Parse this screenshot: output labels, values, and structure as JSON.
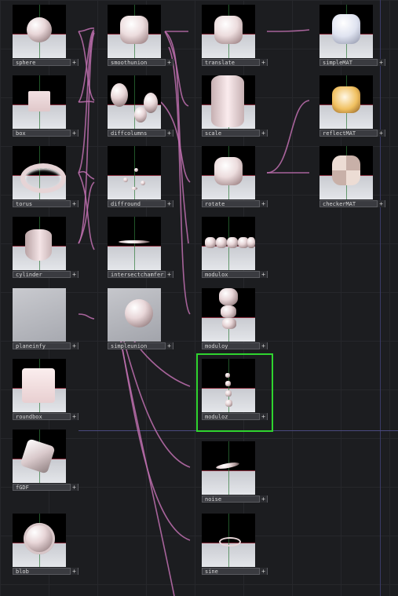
{
  "canvas": {
    "background": "#1c1d20",
    "grid": "#26272b",
    "wire": "#c070b0",
    "selection": "#2fd42f"
  },
  "nodes": [
    {
      "id": "sphere",
      "label": "sphere",
      "shape": "sphere"
    },
    {
      "id": "box",
      "label": "box",
      "shape": "box"
    },
    {
      "id": "torus",
      "label": "torus",
      "shape": "torus"
    },
    {
      "id": "cylinder",
      "label": "cylinder",
      "shape": "cylinder"
    },
    {
      "id": "planeinfy",
      "label": "planeinfy",
      "shape": "plane"
    },
    {
      "id": "roundbox",
      "label": "roundbox",
      "shape": "roundbox"
    },
    {
      "id": "fgdf",
      "label": "fGDF",
      "shape": "gdf"
    },
    {
      "id": "blob",
      "label": "blob",
      "shape": "blob"
    },
    {
      "id": "smoothunion",
      "label": "smoothunion",
      "shape": "roundcube"
    },
    {
      "id": "diffcolumns",
      "label": "diffcolumns",
      "shape": "columns"
    },
    {
      "id": "diffround",
      "label": "diffround",
      "shape": "scatter"
    },
    {
      "id": "intersectchamfer",
      "label": "intersectchamfer",
      "shape": "flat"
    },
    {
      "id": "simpleunion",
      "label": "simpleunion",
      "shape": "sphereplane"
    },
    {
      "id": "translate",
      "label": "translate",
      "shape": "roundcube"
    },
    {
      "id": "scale",
      "label": "scale",
      "shape": "tall"
    },
    {
      "id": "rotate",
      "label": "rotate",
      "shape": "roundcube"
    },
    {
      "id": "modulox",
      "label": "modulox",
      "shape": "rowx"
    },
    {
      "id": "moduloy",
      "label": "moduloy",
      "shape": "stack"
    },
    {
      "id": "moduloz",
      "label": "moduloz",
      "shape": "rowz",
      "selected": true
    },
    {
      "id": "noise",
      "label": "noise",
      "shape": "noise"
    },
    {
      "id": "sine",
      "label": "sine",
      "shape": "ring"
    },
    {
      "id": "simplemat",
      "label": "simpleMAT",
      "shape": "mat"
    },
    {
      "id": "reflectmat",
      "label": "reflectMAT",
      "shape": "reflect"
    },
    {
      "id": "checkermat",
      "label": "checkerMAT",
      "shape": "checker"
    }
  ],
  "view_button": "+"
}
